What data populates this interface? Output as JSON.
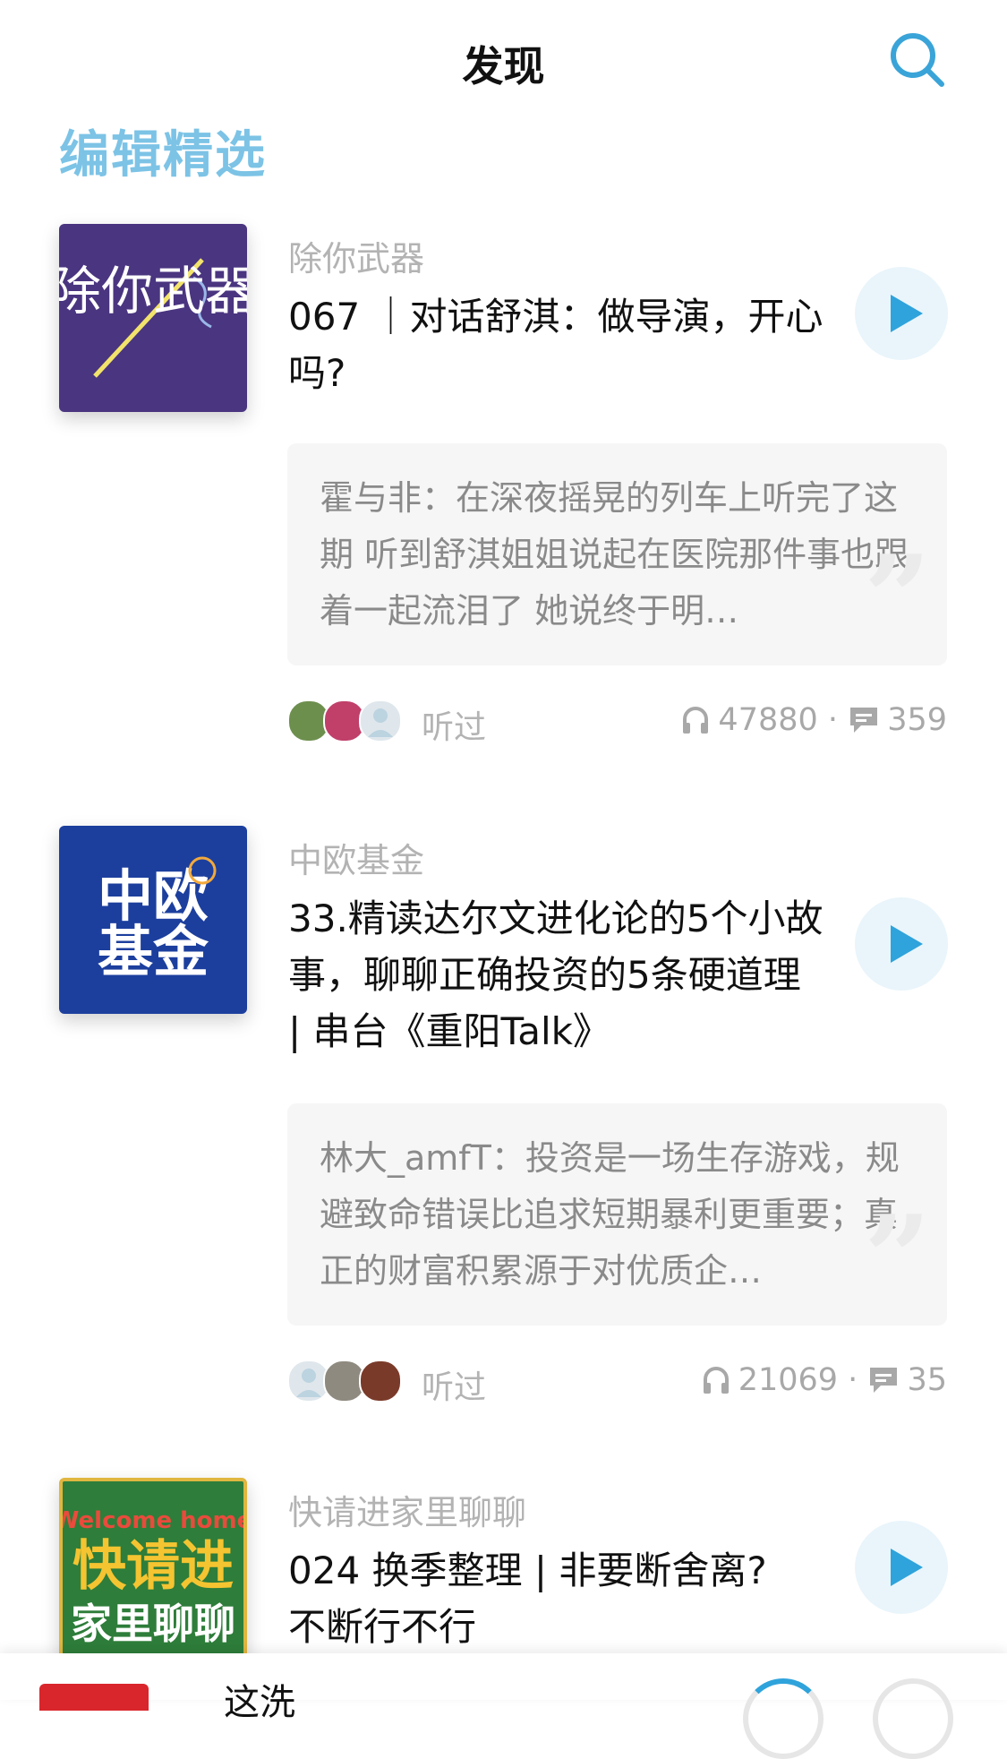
{
  "header": {
    "title": "发现",
    "search_icon": "search-icon",
    "accent": "#3aa4d8"
  },
  "section": {
    "title": "编辑精选",
    "color": "#7cc3e6"
  },
  "episodes": [
    {
      "podcast": "除你武器",
      "title": "067 ｜对话舒淇：做导演，开心吗?",
      "cover_text": "除你武器",
      "cover_color": "#4a3580",
      "comment": "霍与非：在深夜摇晃的列车上听完了这期 听到舒淇姐姐说起在医院那件事也跟着一起流泪了 她说终于明…",
      "listened": "听过",
      "plays": "47880",
      "comments": "359"
    },
    {
      "podcast": "中欧基金",
      "title": "33.精读达尔文进化论的5个小故事，聊聊正确投资的5条硬道理 | 串台《重阳Talk》",
      "cover_text_line1": "中欧",
      "cover_text_line2": "基金",
      "cover_color": "#1c3f9e",
      "comment": "林大_amfT：投资是一场生存游戏，规避致命错误比追求短期暴利更重要；真正的财富积累源于对优质企…",
      "listened": "听过",
      "plays": "21069",
      "comments": "35"
    },
    {
      "podcast": "快请进家里聊聊",
      "title": "024 换季整理 | 非要断舍离?不断行不行",
      "cover_text_top": "Welcome home",
      "cover_text_mid": "快请进",
      "cover_text_bottom": "家里聊聊",
      "cover_color": "#2e7d3a"
    }
  ],
  "stats_separator": "·",
  "mini_player": {
    "title": "这洗"
  }
}
